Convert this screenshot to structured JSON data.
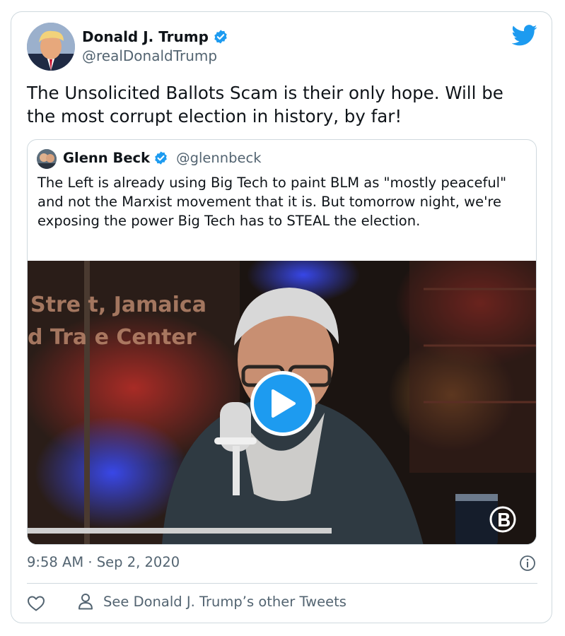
{
  "tweet": {
    "author_name": "Donald J. Trump",
    "author_handle": "@realDonaldTrump",
    "text": "The Unsolicited Ballots Scam is their only hope. Will be the most corrupt election in history, by far!",
    "timestamp": "9:58 AM · Sep 2, 2020"
  },
  "quoted_tweet": {
    "author_name": "Glenn Beck",
    "author_handle": "@glennbeck",
    "text": "The Left is already using Big Tech to paint BLM as \"mostly peaceful\" and not the Marxist movement that it is. But tomorrow night, we're exposing the power Big Tech has to STEAL the election.",
    "media_sign_text": [
      "Stre t, Jamaica",
      "d Tra e Center"
    ]
  },
  "footer": {
    "see_others_label": "See Donald J. Trump’s other Tweets"
  },
  "icons": {
    "platform": "twitter-bird-icon",
    "verified": "verified-badge-icon",
    "play": "play-icon",
    "info": "info-icon",
    "like": "heart-icon",
    "profile": "person-icon",
    "channel_logo": "blaze-logo-icon"
  },
  "colors": {
    "accent": "#1d9bf0",
    "text_primary": "#0f1419",
    "text_secondary": "#536471",
    "border": "#cfd9de"
  }
}
